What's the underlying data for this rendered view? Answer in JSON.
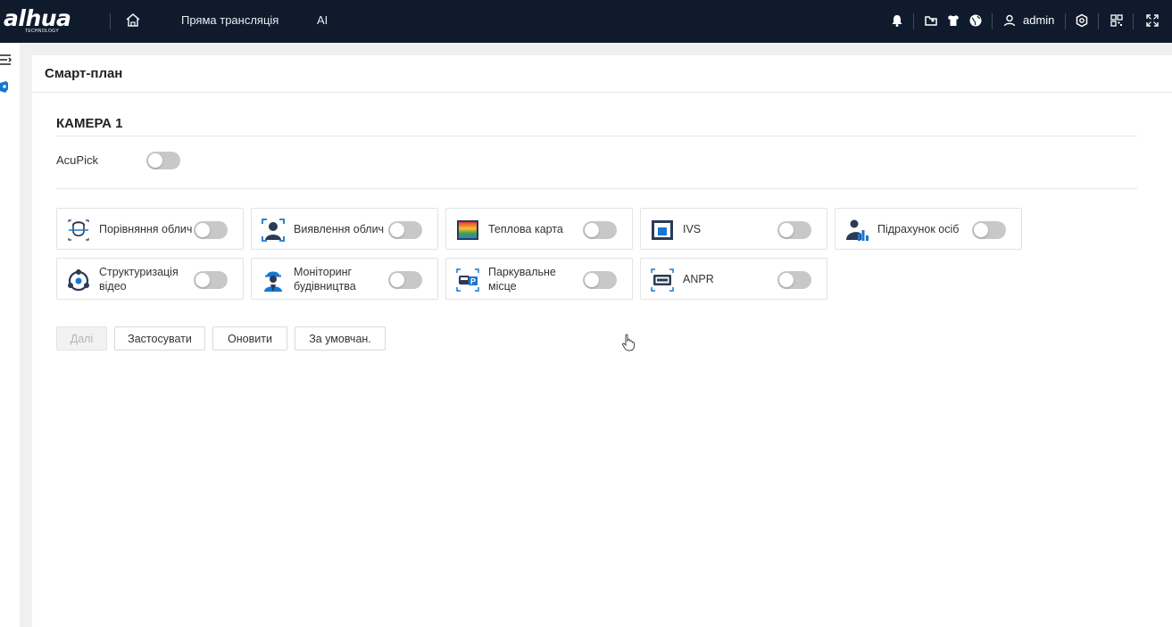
{
  "header": {
    "logo": "alhua",
    "logo_tag": "TECHNOLOGY",
    "nav": {
      "live": "Пряма трансляція",
      "ai": "AI"
    },
    "username": "admin",
    "icons": [
      "home-icon",
      "bell-icon",
      "export-icon",
      "shirt-icon",
      "globe-icon",
      "user-icon",
      "settings-icon",
      "qr-code-icon",
      "fullscreen-icon"
    ]
  },
  "page": {
    "title": "Смарт-план",
    "camera_title": "КАМЕРА 1",
    "acupick_label": "AcuPick",
    "acupick_enabled": false
  },
  "plans": [
    {
      "label": "Порівняння облич",
      "icon": "face-compare-icon",
      "enabled": false
    },
    {
      "label": "Виявлення облич",
      "icon": "face-detect-icon",
      "enabled": false
    },
    {
      "label": "Теплова карта",
      "icon": "heatmap-icon",
      "enabled": false
    },
    {
      "label": "IVS",
      "icon": "ivs-icon",
      "enabled": false
    },
    {
      "label": "Підрахунок осіб",
      "icon": "people-count-icon",
      "enabled": false
    },
    {
      "label": "Структуризація відео",
      "icon": "video-struct-icon",
      "enabled": false
    },
    {
      "label": "Моніторинг будівництва",
      "icon": "construction-worker-icon",
      "enabled": false
    },
    {
      "label": "Паркувальне місце",
      "icon": "parking-icon",
      "enabled": false
    },
    {
      "label": "ANPR",
      "icon": "anpr-icon",
      "enabled": false
    }
  ],
  "buttons": {
    "next": "Далі",
    "apply": "Застосувати",
    "refresh": "Оновити",
    "default": "За умовчан."
  },
  "colors": {
    "topbar": "#0f1b2d",
    "accent": "#1677d2",
    "toggle_off": "#c8c8c8"
  }
}
